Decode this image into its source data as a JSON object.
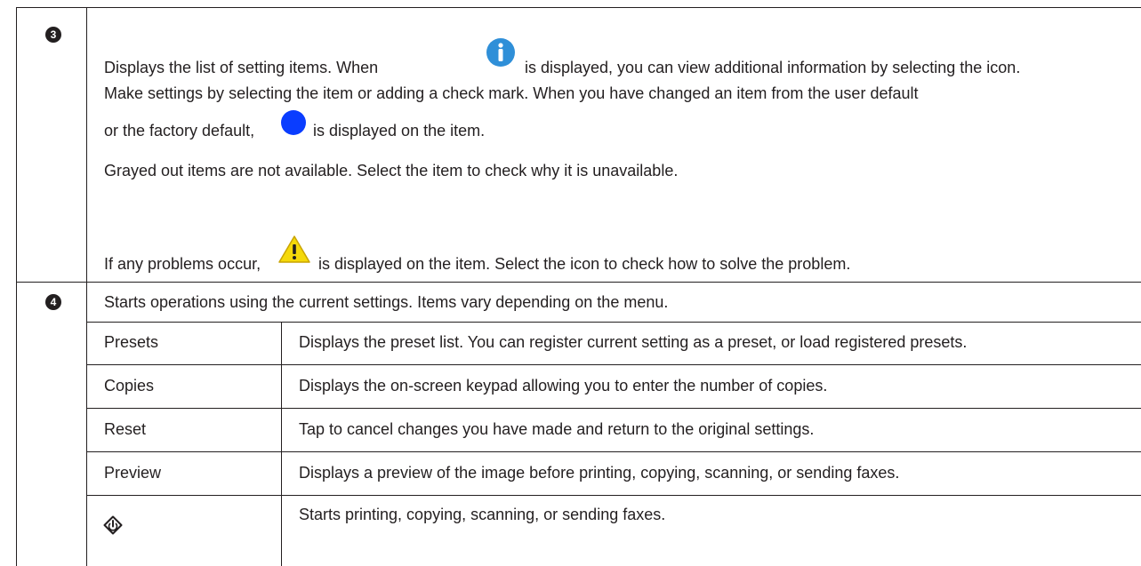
{
  "row3": {
    "marker": "3",
    "line1_a": "Displays the list of setting items. When",
    "line1_b": "is displayed, you can view additional information by selecting the icon.",
    "line2": "Make settings by selecting the item or adding a check mark. When you have changed an item from the user default",
    "line3_a": "or the factory default,",
    "line3_b": "is displayed on the item.",
    "line4": "Grayed out items are not available. Select the item to check why it is unavailable.",
    "line5_a": "If any problems occur,",
    "line5_b": "is displayed on the item. Select the icon to check how to solve the problem."
  },
  "row4": {
    "marker": "4",
    "intro": "Starts operations using the current settings. Items vary depending on the menu.",
    "items": [
      {
        "label": "Presets",
        "desc": "Displays the preset list. You can register current setting as a preset, or load registered presets."
      },
      {
        "label": "Copies",
        "desc": "Displays the on-screen keypad allowing you to enter the number of copies."
      },
      {
        "label": "Reset",
        "desc": "Tap to cancel changes you have made and return to the original settings."
      },
      {
        "label": "Preview",
        "desc": "Displays a preview of the image before printing, copying, scanning, or sending faxes."
      },
      {
        "label": "",
        "desc": "Starts printing, copying, scanning, or sending faxes.",
        "icon": "start-diamond-icon"
      }
    ]
  },
  "icons": {
    "info": "info-icon",
    "changed_dot": "blue-dot-icon",
    "warning": "warning-icon",
    "info_color": "#2f8fd8",
    "dot_color": "#0a3dff",
    "warning_color": "#f5d90a"
  }
}
